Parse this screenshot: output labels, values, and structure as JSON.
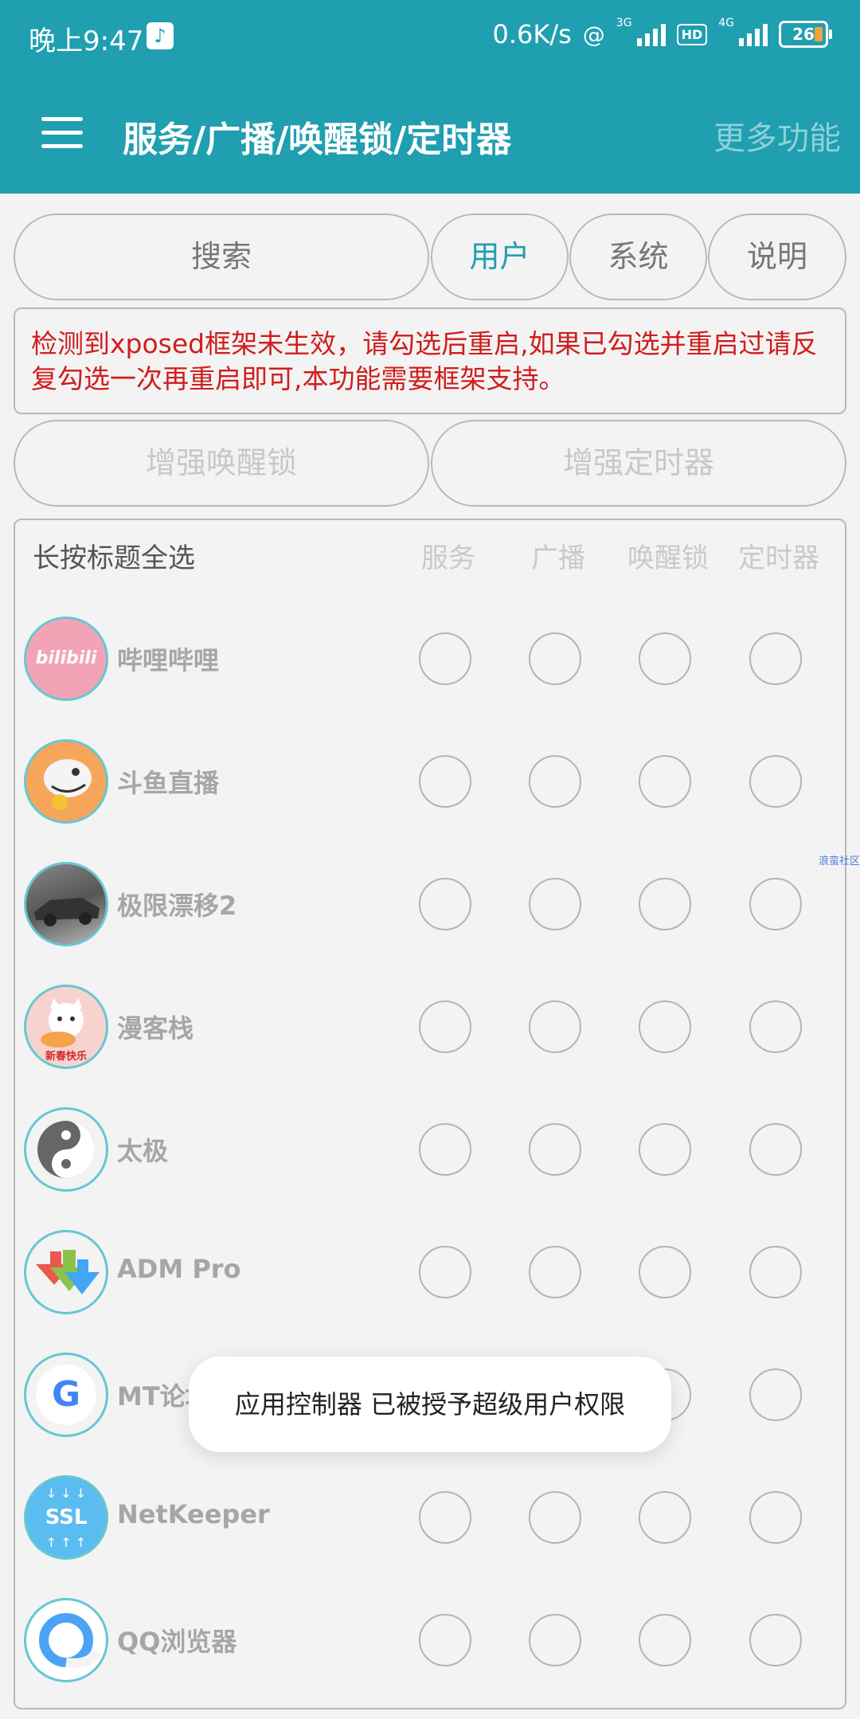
{
  "status_bar": {
    "time": "晚上9:47",
    "network_speed": "0.6K/s",
    "net1": "3G",
    "hd": "HD",
    "net2": "4G",
    "battery": "26"
  },
  "app_bar": {
    "title": "服务/广播/唤醒锁/定时器",
    "more": "更多功能"
  },
  "controls": {
    "search": "搜索",
    "tab_user": "用户",
    "tab_system": "系统",
    "tab_help": "说明",
    "enhance_wakelock": "增强唤醒锁",
    "enhance_timer": "增强定时器"
  },
  "notice": "检测到xposed框架未生效，请勾选后重启,如果已勾选并重启过请反复勾选一次再重启即可,本功能需要框架支持。",
  "table": {
    "header_label": "长按标题全选",
    "columns": [
      "服务",
      "广播",
      "唤醒锁",
      "定时器"
    ],
    "rows": [
      {
        "name": "哔哩哔哩",
        "icon": "bilibili-icon",
        "icon_text": "bilibili"
      },
      {
        "name": "斗鱼直播",
        "icon": "douyu-icon"
      },
      {
        "name": "极限漂移2",
        "icon": "car-drift-icon"
      },
      {
        "name": "漫客栈",
        "icon": "cat-icon",
        "icon_text": "新春快乐"
      },
      {
        "name": "太极",
        "icon": "yin-yang-icon"
      },
      {
        "name": "ADM Pro",
        "icon": "download-arrows-icon"
      },
      {
        "name": "MT论坛",
        "icon": "google-g-icon",
        "icon_text": "G"
      },
      {
        "name": "NetKeeper",
        "icon": "ssl-icon",
        "icon_text": "SSL"
      },
      {
        "name": "QQ浏览器",
        "icon": "qq-browser-icon"
      }
    ]
  },
  "watermark": "浪蛮社区",
  "toast": "应用控制器 已被授予超级用户权限",
  "colors": {
    "primary": "#1f9fb0",
    "notice_text": "#d01d1d",
    "accent_tab": "#1f9fb0"
  }
}
